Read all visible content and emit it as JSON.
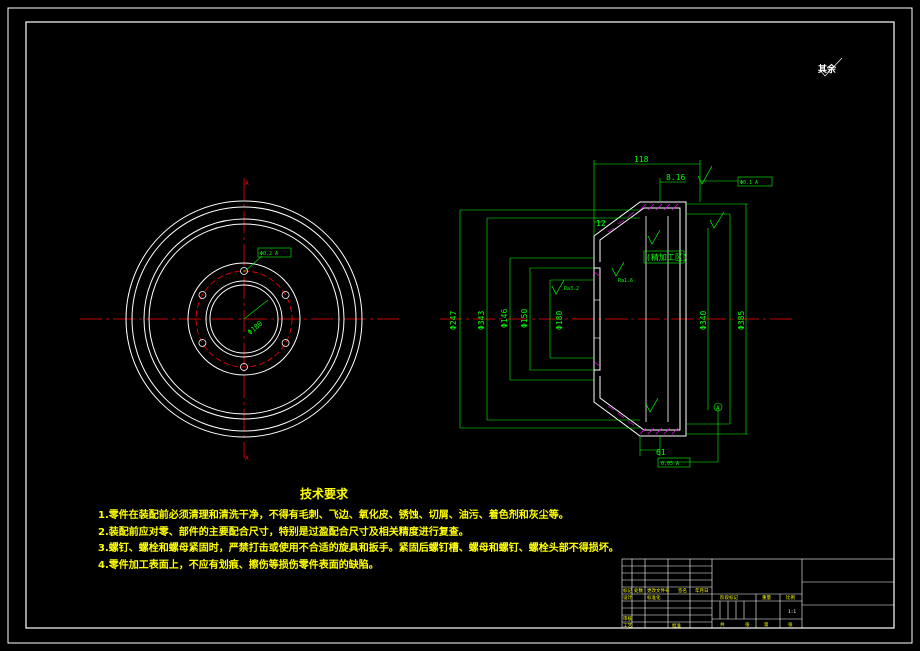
{
  "colors": {
    "background": "#000000",
    "outline": "#ffffff",
    "dimension": "#00ff00",
    "centerline": "#ff0000",
    "hidden": "#ff0000",
    "section": "#ff00ff",
    "text": "#ffff00",
    "frame": "#ffffff"
  },
  "rough_note": "其余",
  "notes": {
    "title": "技术要求",
    "items": [
      "1.零件在装配前必须清理和清洗干净，不得有毛刺、飞边、氧化皮、锈蚀、切屑、油污、着色剂和灰尘等。",
      "2.装配前应对零、部件的主要配合尺寸，特别是过盈配合尺寸及相关精度进行复查。",
      "3.螺钉、螺栓和螺母紧固时，严禁打击或使用不合适的旋具和扳手。紧固后螺钉槽、螺母和螺钉、螺栓头部不得损坏。",
      "4.零件加工表面上，不应有划痕、擦伤等损伤零件表面的缺陷。"
    ]
  },
  "dimensions": {
    "overall_width": "118",
    "flange_gap": "8.16",
    "note_left": "12",
    "machining_note": "(精加工区)",
    "d_outer": "Φ247",
    "d_343": "Φ343",
    "d_146": "Φ146",
    "d_inner": "Φ150",
    "d_180": "Φ180",
    "d_right1": "Φ340",
    "d_right2": "Φ385",
    "bottom_61": "61",
    "pcd": "Φ180",
    "tol_top": "Φ0.1 A",
    "tol_left": "Φ0.2 A",
    "tol_bottom": "0.05 A",
    "datum": "A",
    "ra1": "Ra3.2",
    "ra2": "Ra1.6"
  },
  "title_block": {
    "labels": [
      "标记",
      "处数",
      "分区",
      "更改文件号",
      "签名",
      "年月日",
      "设计",
      "标准化",
      "阶段标记",
      "重量",
      "比例",
      "审核",
      "工艺",
      "批准",
      "共",
      "张",
      "第",
      "张"
    ],
    "scale": "1:1"
  }
}
